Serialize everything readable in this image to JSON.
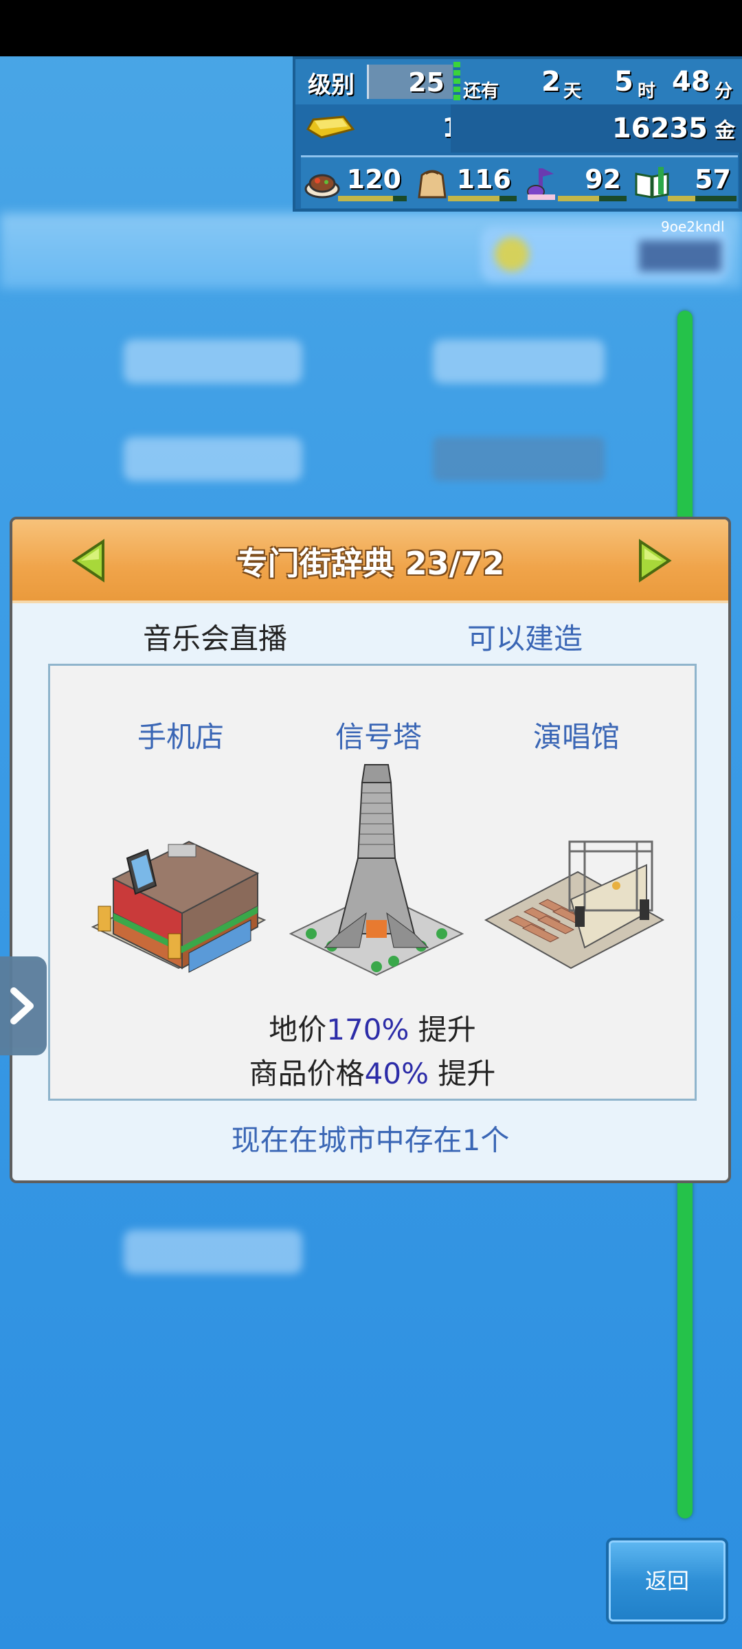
{
  "hud": {
    "level_label": "级别",
    "level_value": "25",
    "time_prefix": "还有",
    "days_value": "2",
    "days_unit": "天",
    "hours_value": "5",
    "hours_unit": "时",
    "minutes_value": "48",
    "minutes_unit": "分",
    "gold_bar_count": "1",
    "money_value": "16235",
    "money_unit": "金",
    "stats": [
      {
        "icon": "food-icon",
        "value": "120",
        "fill": 0.8
      },
      {
        "icon": "goods-bag-icon",
        "value": "116",
        "fill": 0.75
      },
      {
        "icon": "music-note-icon",
        "value": "92",
        "fill": 0.6
      },
      {
        "icon": "book-icon",
        "value": "57",
        "fill": 0.4
      }
    ],
    "code_text": "9oe2kndl"
  },
  "dialog": {
    "title": "专门街辞典 23/72",
    "building_name": "音乐会直播",
    "status": "可以建造",
    "ingredients": [
      "手机店",
      "信号塔",
      "演唱馆"
    ],
    "effect_land_prefix": "地价",
    "effect_land_pct": "170%",
    "effect_land_suffix": " 提升",
    "effect_price_prefix": "商品价格",
    "effect_price_pct": "40%",
    "effect_price_suffix": " 提升",
    "exist_text": "现在在城市中存在1个"
  },
  "back_button_label": "返回",
  "colors": {
    "header_orange": "#f0a44a",
    "link_blue": "#3a66b5",
    "percent_blue": "#2c2ca8",
    "track_green": "#25c24a"
  }
}
